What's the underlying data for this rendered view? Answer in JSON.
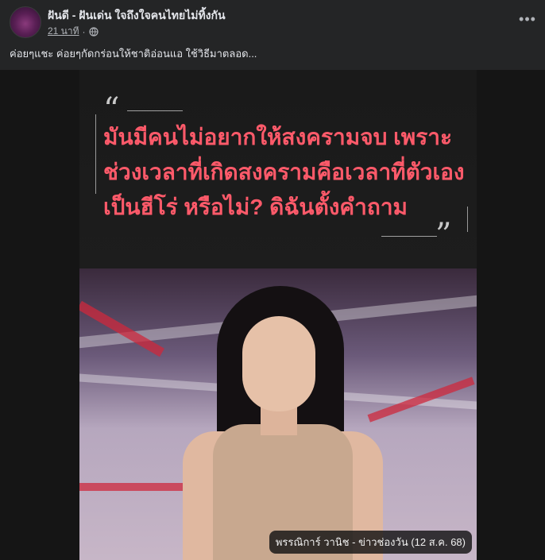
{
  "post": {
    "page_name": "ฝันดี - ฝันเด่น ใจถึงใจคนไทยไม่ทิ้งกัน",
    "timestamp": "21 นาที",
    "privacy_icon": "globe-icon",
    "more_label": "•••",
    "caption": "ค่อยๆแชะ ค่อยๆกัดกร่อนให้ชาติอ่อนแอ ใช้วิธีมาตลอด..."
  },
  "media": {
    "quote_open": "“",
    "quote_close": "”",
    "quote_lines": [
      "มันมีคนไม่อยากให้สงครามจบ เพราะ",
      "ช่วงเวลาที่เกิดสงครามคือเวลาที่ตัวเอง",
      "เป็นฮีโร่ หรือไม่? ดิฉันตั้งคำถาม"
    ],
    "credit": "พรรณิการ์ วานิช - ข่าวช่องวัน (12 ส.ค. 68)"
  },
  "colors": {
    "background": "#242526",
    "quote_text": "#ff5a6a",
    "secondary_text": "#b0b3b8"
  }
}
